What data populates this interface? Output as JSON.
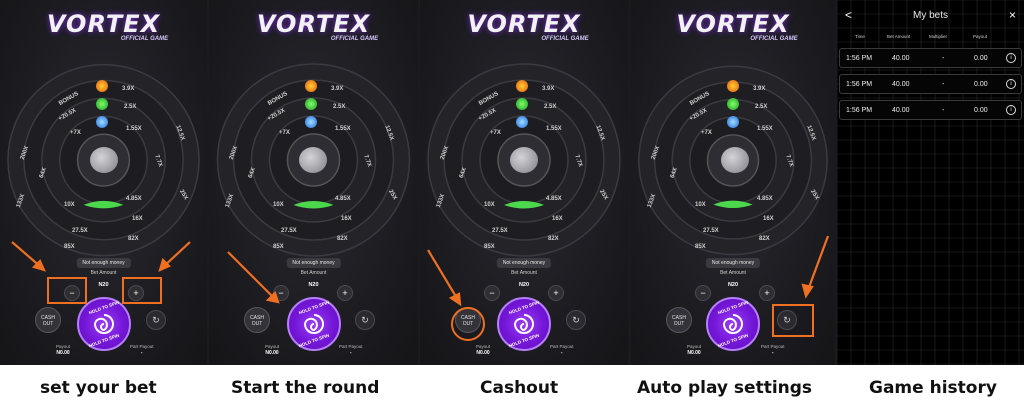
{
  "game": {
    "logo": "VORTEX",
    "logo_sub": "OFFICIAL GAME",
    "outer_ring_labels": [
      "200X",
      "64X",
      "133X",
      "10X",
      "27.5X",
      "85X",
      "82X",
      "25X",
      "7.7X",
      "12.5X"
    ],
    "mid_ring_labels": [
      "BONUS",
      "+20.5X",
      "3.9X",
      "2.5X",
      "1.55X",
      "4.85X",
      "16X"
    ],
    "inner_ring_labels": [
      "+7X",
      "1.5X"
    ],
    "notice": "Not enough money",
    "bet_amount_label": "Bet Amount",
    "bet_value": "N20",
    "minus_label": "−",
    "plus_label": "+",
    "cashout_line1": "CASH",
    "cashout_line2": "OUT",
    "spin_top": "HOLD TO SPIN",
    "spin_bottom": "HOLD TO SPIN",
    "auto_icon": "↻",
    "payout_label": "Payout",
    "payout_value": "N0.00",
    "part_payout_label": "Part Payout",
    "part_payout_value": "-",
    "icons": [
      "fire-icon",
      "clover-icon",
      "water-icon",
      "elephant-icon"
    ]
  },
  "captions": {
    "c1": "set your bet",
    "c2": "Start the round",
    "c3": "Cashout",
    "c4": "Auto play settings",
    "c5": "Game history"
  },
  "my_bets": {
    "title": "My bets",
    "back": "<",
    "close": "×",
    "columns": [
      "Time",
      "Bet Amount",
      "Multiplier",
      "Payout"
    ],
    "rows": [
      {
        "time": "1:56 PM",
        "bet": "40.00",
        "mult": "-",
        "payout": "0.00"
      },
      {
        "time": "1:56 PM",
        "bet": "40.00",
        "mult": "-",
        "payout": "0.00"
      },
      {
        "time": "1:56 PM",
        "bet": "40.00",
        "mult": "-",
        "payout": "0.00"
      }
    ],
    "info_icon": "i"
  },
  "colors": {
    "highlight": "#f07022",
    "spin_purple": "#7416d8",
    "background": "#1c1c21"
  }
}
